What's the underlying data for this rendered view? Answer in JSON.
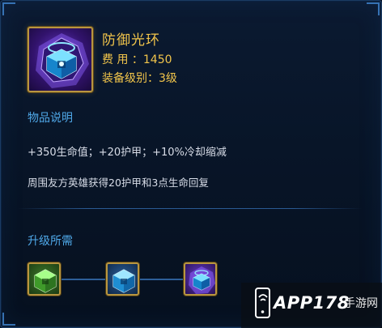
{
  "item": {
    "name": "防御光环",
    "cost": "费 用 ：1450",
    "level": "装备级别：3级",
    "icon": "crystal-cube-aura-icon"
  },
  "description": {
    "section_title": "物品说明",
    "stats": "+350生命值；+20护甲；+10%冷却缩减",
    "passive": "周围友方英雄获得20护甲和3点生命回复"
  },
  "upgrade": {
    "section_title": "升级所需",
    "requirements": [
      {
        "icon": "green-cube-icon"
      },
      {
        "icon": "blue-cube-icon"
      },
      {
        "icon": "purple-crystal-cube-icon"
      }
    ]
  },
  "watermark": {
    "brand": "APP178",
    "subtitle": "手游网"
  },
  "colors": {
    "gold": "#f2c54b",
    "section_blue": "#4fa8e8",
    "text": "#d8dde8",
    "background": "#081528"
  }
}
